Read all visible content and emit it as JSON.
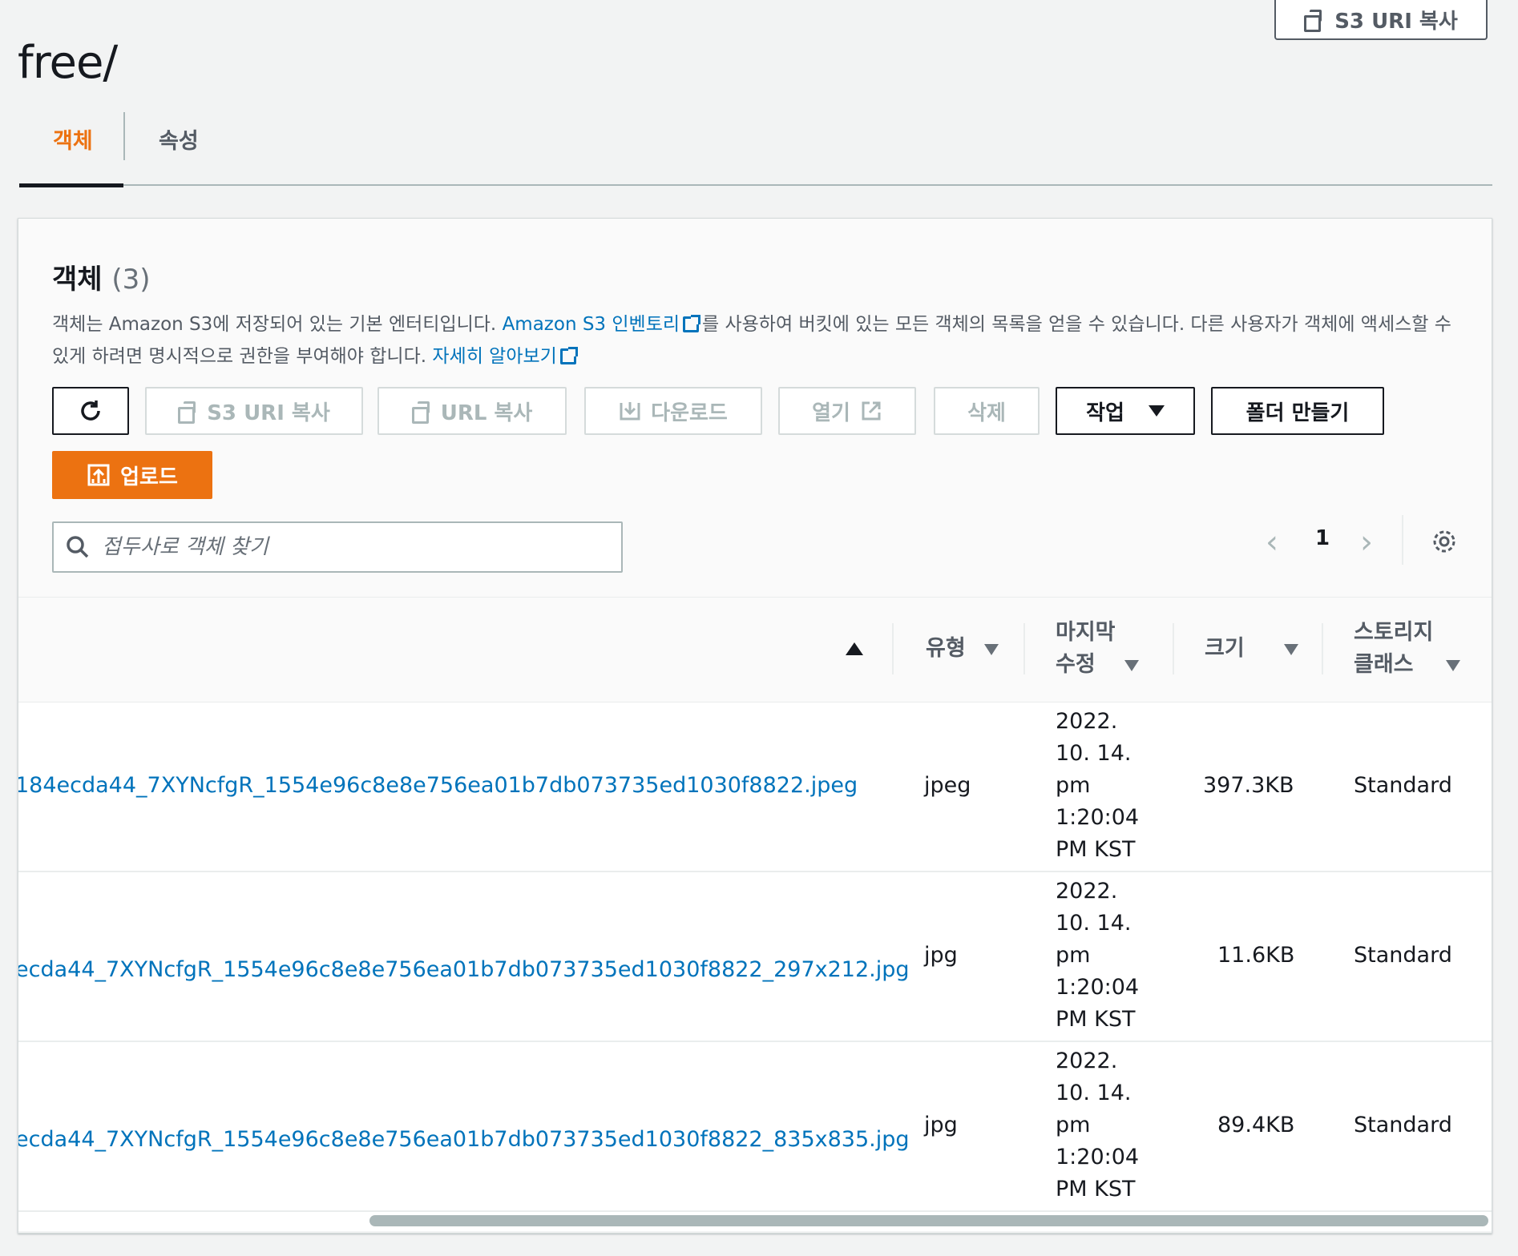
{
  "header": {
    "title": "free/",
    "copy_uri_label": "S3 URI 복사"
  },
  "tabs": [
    {
      "label": "객체",
      "active": true
    },
    {
      "label": "속성",
      "active": false
    }
  ],
  "objects_panel": {
    "title": "객체",
    "count": "(3)",
    "description": {
      "part1": "객체는 Amazon S3에 저장되어 있는 기본 엔터티입니다. ",
      "inventory_link": "Amazon S3 인벤토리",
      "part2": "를 사용하여 버킷에 있는 모든 객체의 목록을 얻을 수 있습니다. 다른 사용자가 객체에 액세스할 수 있게 하려면 명시적으로 권한을 부여해야 합니다. ",
      "learn_more_link": "자세히 알아보기"
    },
    "toolbar": {
      "copy_s3_uri": "S3 URI 복사",
      "copy_url": "URL 복사",
      "download": "다운로드",
      "open": "열기",
      "delete": "삭제",
      "actions": "작업",
      "create_folder": "폴더 만들기",
      "upload": "업로드"
    },
    "search": {
      "placeholder": "접두사로 객체 찾기"
    },
    "pagination": {
      "current_page": "1"
    },
    "columns": {
      "type": "유형",
      "last_modified_1": "마지막",
      "last_modified_2": "수정",
      "size": "크기",
      "storage_class_1": "스토리지",
      "storage_class_2": "클래스"
    },
    "rows": [
      {
        "name": "184ecda44_7XYNcfgR_1554e96c8e8e756ea01b7db073735ed1030f8822.jpeg",
        "type": "jpeg",
        "modified": [
          "2022.",
          "10. 14.",
          "pm",
          "1:20:04",
          "PM KST"
        ],
        "size": "397.3KB",
        "storage_class": "Standard"
      },
      {
        "name": "ecda44_7XYNcfgR_1554e96c8e8e756ea01b7db073735ed1030f8822_297x212.jpg",
        "type": "jpg",
        "modified": [
          "2022.",
          "10. 14.",
          "pm",
          "1:20:04",
          "PM KST"
        ],
        "size": "11.6KB",
        "storage_class": "Standard"
      },
      {
        "name": "ecda44_7XYNcfgR_1554e96c8e8e756ea01b7db073735ed1030f8822_835x835.jpg",
        "type": "jpg",
        "modified": [
          "2022.",
          "10. 14.",
          "pm",
          "1:20:04",
          "PM KST"
        ],
        "size": "89.4KB",
        "storage_class": "Standard"
      }
    ]
  },
  "colors": {
    "accent": "#ec7211",
    "link": "#0073bb",
    "text": "#16191f",
    "muted": "#545b64",
    "disabled": "#aab7b8"
  }
}
